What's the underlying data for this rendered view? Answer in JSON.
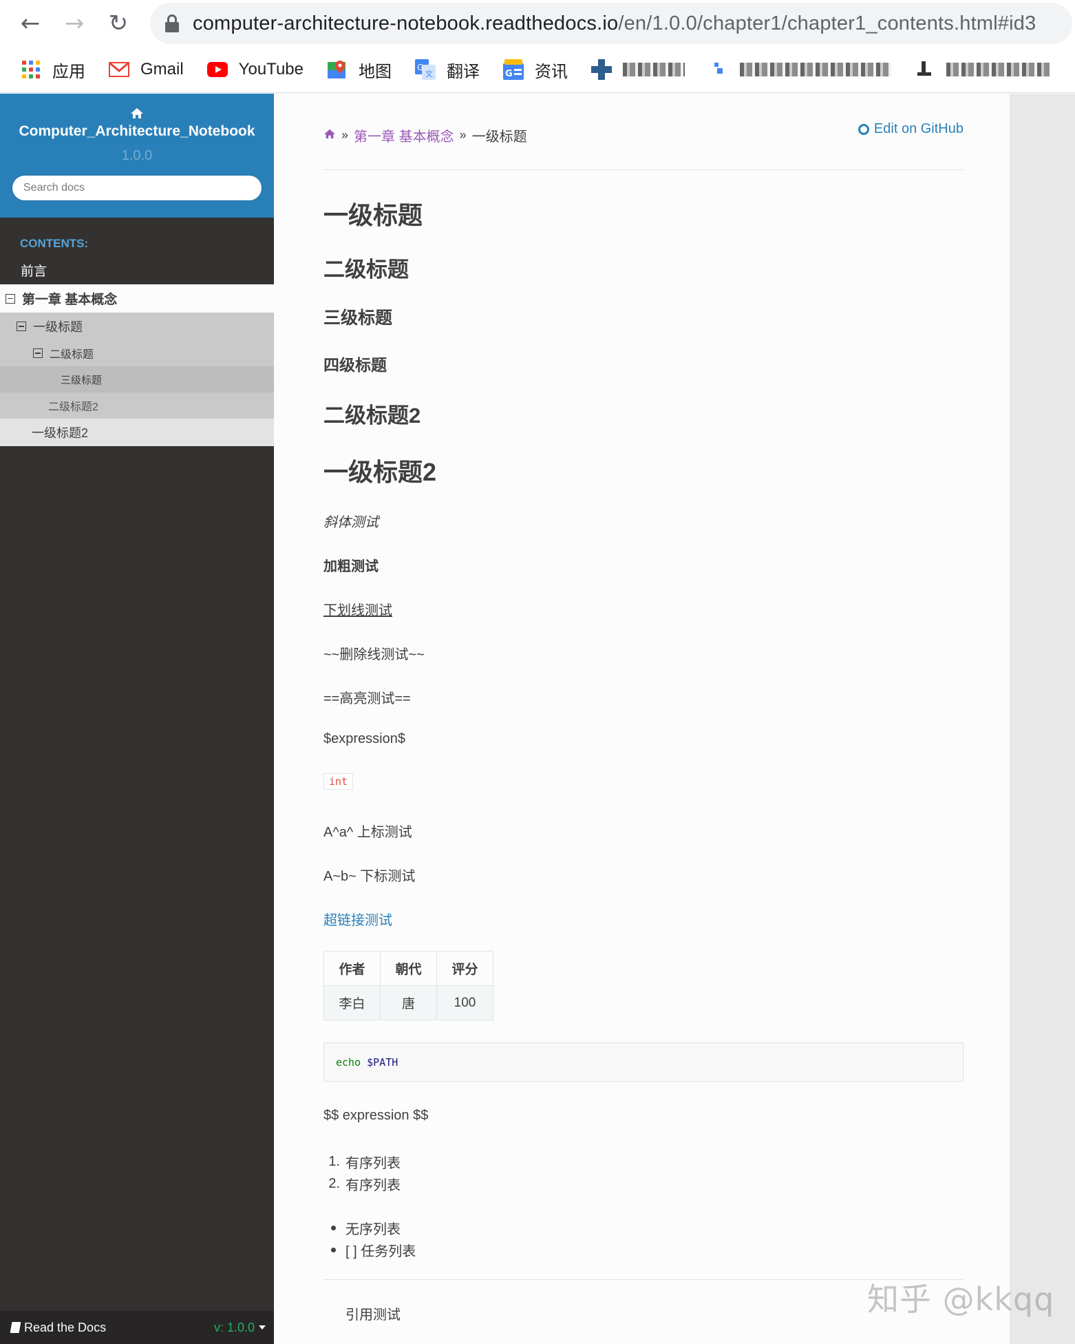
{
  "browser": {
    "url_host": "computer-architecture-notebook.readthedocs.io",
    "url_path": "/en/1.0.0/chapter1/chapter1_contents.html#id3",
    "bookmarks": [
      {
        "label": "应用",
        "icon": "apps-grid-icon"
      },
      {
        "label": "Gmail",
        "icon": "gmail-icon",
        "color": "#ea4335"
      },
      {
        "label": "YouTube",
        "icon": "youtube-icon",
        "color": "#ff0000"
      },
      {
        "label": "地图",
        "icon": "maps-icon",
        "color": "#34a853"
      },
      {
        "label": "翻译",
        "icon": "translate-icon",
        "color": "#4285f4"
      },
      {
        "label": "资讯",
        "icon": "news-icon",
        "color": "#4285f4"
      }
    ]
  },
  "sidebar": {
    "project": "Computer_Architecture_Notebook",
    "version": "1.0.0",
    "search_placeholder": "Search docs",
    "caption": "CONTENTS:",
    "toc": [
      {
        "label": "前言"
      },
      {
        "label": "第一章 基本概念"
      },
      {
        "label": "一级标题"
      },
      {
        "label": "二级标题"
      },
      {
        "label": "三级标题"
      },
      {
        "label": "二级标题2"
      },
      {
        "label": "一级标题2"
      }
    ],
    "rtd_label": "Read the Docs",
    "rtd_version": "v: 1.0.0"
  },
  "colors": {
    "sidebar_header": "#2980b9",
    "sidebar_bg": "#343131",
    "link": "#2980b9",
    "visited_link": "#9b59b6",
    "rtd_version": "#27ae60"
  },
  "breadcrumbs": {
    "sep": "»",
    "chapter": "第一章 基本概念",
    "current": "一级标题",
    "edit_link": "Edit on GitHub"
  },
  "doc": {
    "h1": "一级标题",
    "h2": "二级标题",
    "h3": "三级标题",
    "h4": "四级标题",
    "h2b": "二级标题2",
    "h1b": "一级标题2",
    "italic": "斜体测试",
    "bold": "加粗测试",
    "underline": "下划线测试",
    "strike": "~~删除线测试~~",
    "highlight": "==高亮测试==",
    "expression": "$expression$",
    "inline_code": "int",
    "superscript": "A^a^ 上标测试",
    "subscript": "A~b~ 下标测试",
    "hyperlink": "超链接测试",
    "table": {
      "headers": [
        "作者",
        "朝代",
        "评分"
      ],
      "rows": [
        [
          "李白",
          "唐",
          "100"
        ]
      ]
    },
    "code_block": {
      "keyword": "echo",
      "variable": "$PATH"
    },
    "block_expression": "$$ expression $$",
    "ordered_list": [
      {
        "marker": "1.",
        "text": "有序列表"
      },
      {
        "marker": "2.",
        "text": "有序列表"
      }
    ],
    "unordered_list": [
      "无序列表",
      "[ ] 任务列表"
    ],
    "quote": "引用测试"
  },
  "watermark": "知乎 @kkqq"
}
